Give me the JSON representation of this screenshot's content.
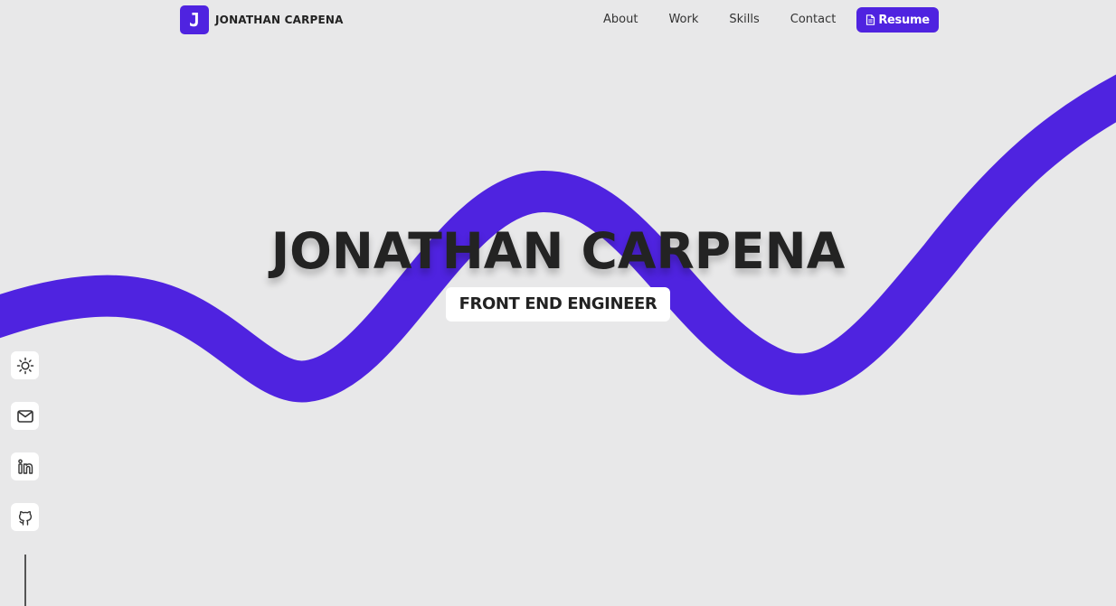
{
  "header": {
    "logo_letter": "J",
    "brand_name": "JONATHAN CARPENA",
    "nav": [
      {
        "label": "About"
      },
      {
        "label": "Work"
      },
      {
        "label": "Skills"
      },
      {
        "label": "Contact"
      }
    ],
    "resume_label": "Resume"
  },
  "hero": {
    "title": "JONATHAN CARPENA",
    "subtitle": "FRONT END ENGINEER"
  },
  "sidebar": {
    "items": [
      {
        "icon": "sun-icon"
      },
      {
        "icon": "mail-icon"
      },
      {
        "icon": "linkedin-icon"
      },
      {
        "icon": "github-icon"
      }
    ]
  },
  "colors": {
    "accent": "#4f23e0",
    "background": "#e8e8e9",
    "text": "#232323"
  }
}
